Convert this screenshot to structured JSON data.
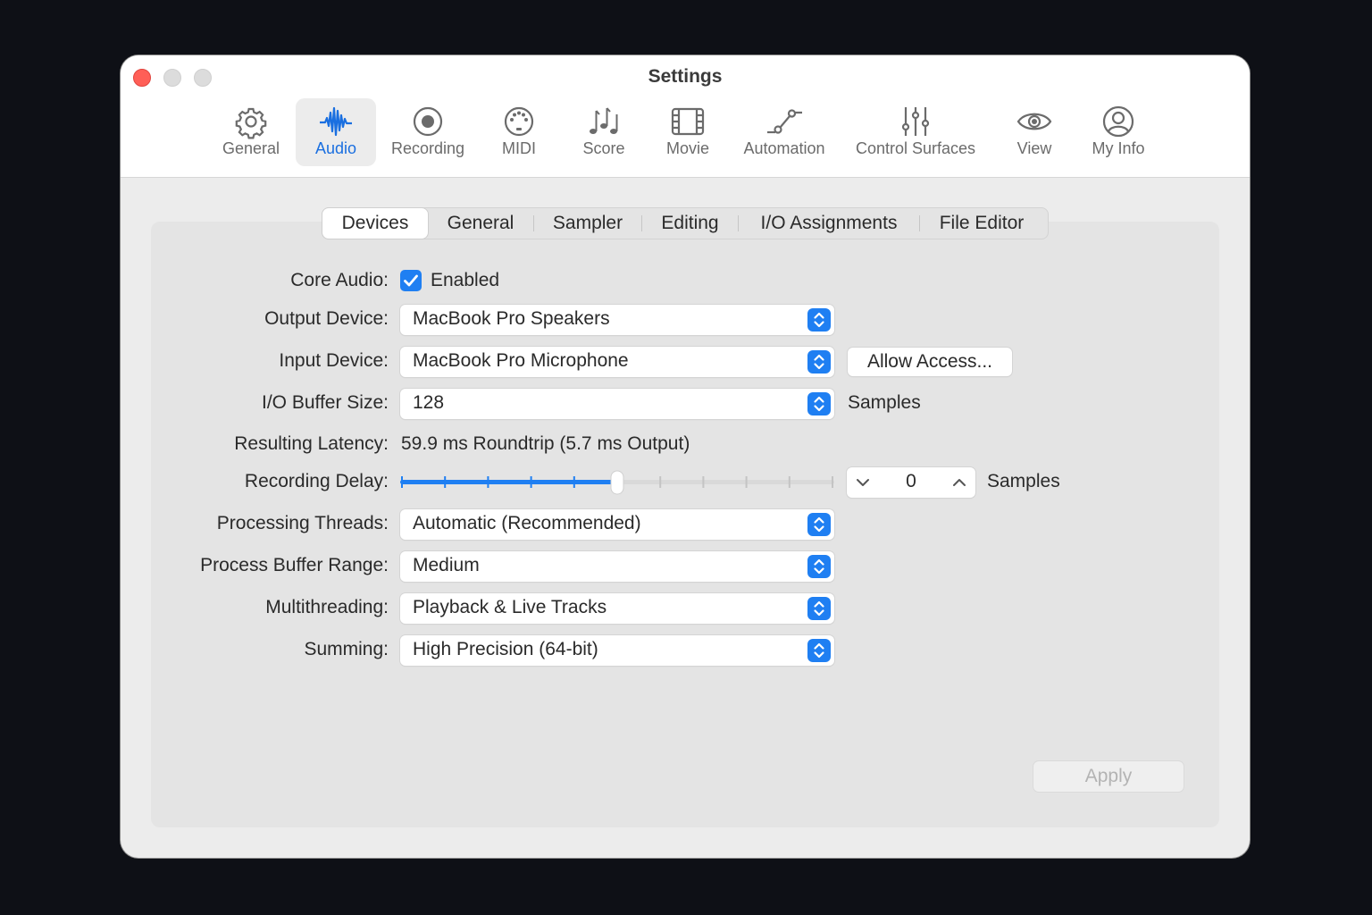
{
  "window": {
    "title": "Settings"
  },
  "toolbar": {
    "items": [
      {
        "label": "General",
        "icon": "gear-icon",
        "selected": false
      },
      {
        "label": "Audio",
        "icon": "waveform-icon",
        "selected": true
      },
      {
        "label": "Recording",
        "icon": "record-icon",
        "selected": false
      },
      {
        "label": "MIDI",
        "icon": "midi-connector-icon",
        "selected": false
      },
      {
        "label": "Score",
        "icon": "music-notes-icon",
        "selected": false
      },
      {
        "label": "Movie",
        "icon": "film-icon",
        "selected": false
      },
      {
        "label": "Automation",
        "icon": "automation-curve-icon",
        "selected": false
      },
      {
        "label": "Control Surfaces",
        "icon": "faders-icon",
        "selected": false
      },
      {
        "label": "View",
        "icon": "eye-icon",
        "selected": false
      },
      {
        "label": "My Info",
        "icon": "person-circle-icon",
        "selected": false
      }
    ]
  },
  "tabs": [
    {
      "label": "Devices",
      "selected": true
    },
    {
      "label": "General",
      "selected": false
    },
    {
      "label": "Sampler",
      "selected": false
    },
    {
      "label": "Editing",
      "selected": false
    },
    {
      "label": "I/O Assignments",
      "selected": false
    },
    {
      "label": "File Editor",
      "selected": false
    }
  ],
  "form": {
    "core_audio": {
      "label": "Core Audio:",
      "checkbox_label": "Enabled",
      "checked": true
    },
    "output_device": {
      "label": "Output Device:",
      "value": "MacBook Pro Speakers"
    },
    "input_device": {
      "label": "Input Device:",
      "value": "MacBook Pro Microphone",
      "button": "Allow Access..."
    },
    "buffer_size": {
      "label": "I/O Buffer Size:",
      "value": "128",
      "unit": "Samples"
    },
    "latency": {
      "label": "Resulting Latency:",
      "value": "59.9 ms Roundtrip (5.7 ms Output)"
    },
    "recording_delay": {
      "label": "Recording Delay:",
      "slider_fraction": 0.5,
      "tick_count": 11,
      "value": "0",
      "unit": "Samples"
    },
    "processing_threads": {
      "label": "Processing Threads:",
      "value": "Automatic (Recommended)"
    },
    "process_buffer_range": {
      "label": "Process Buffer Range:",
      "value": "Medium"
    },
    "multithreading": {
      "label": "Multithreading:",
      "value": "Playback & Live Tracks"
    },
    "summing": {
      "label": "Summing:",
      "value": "High Precision (64-bit)"
    }
  },
  "footer": {
    "apply_label": "Apply",
    "apply_enabled": false
  },
  "colors": {
    "accent": "#1f7ff2",
    "close": "#ff5f57",
    "selected_label": "#1a6fe0"
  }
}
